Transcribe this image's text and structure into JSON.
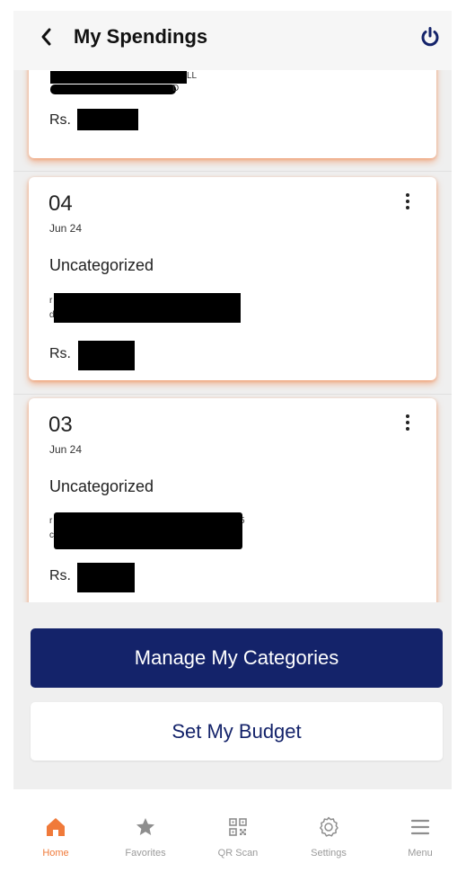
{
  "header": {
    "title": "My Spendings",
    "back_icon": "chevron-left-icon",
    "power_icon": "power-icon",
    "accent": "#14236a"
  },
  "transactions": [
    {
      "peek_a": "LL",
      "peek_b": "D",
      "amount_prefix": "Rs."
    },
    {
      "day": "04",
      "date": "Jun 24",
      "category": "Uncategorized",
      "peek_a": "r",
      "peek_b": "d",
      "amount_prefix": "Rs."
    },
    {
      "day": "03",
      "date": "Jun 24",
      "category": "Uncategorized",
      "peek_a": "r",
      "peek_c": "5",
      "peek_b": "c",
      "amount_prefix": "Rs."
    }
  ],
  "buttons": {
    "manage": "Manage My Categories",
    "budget": "Set My Budget"
  },
  "nav": {
    "active_color": "#f07a3a",
    "items": [
      {
        "label": "Home",
        "icon": "home-icon"
      },
      {
        "label": "Favorites",
        "icon": "star-icon"
      },
      {
        "label": "QR Scan",
        "icon": "qr-code-icon"
      },
      {
        "label": "Settings",
        "icon": "gear-icon"
      },
      {
        "label": "Menu",
        "icon": "hamburger-menu-icon"
      }
    ]
  }
}
